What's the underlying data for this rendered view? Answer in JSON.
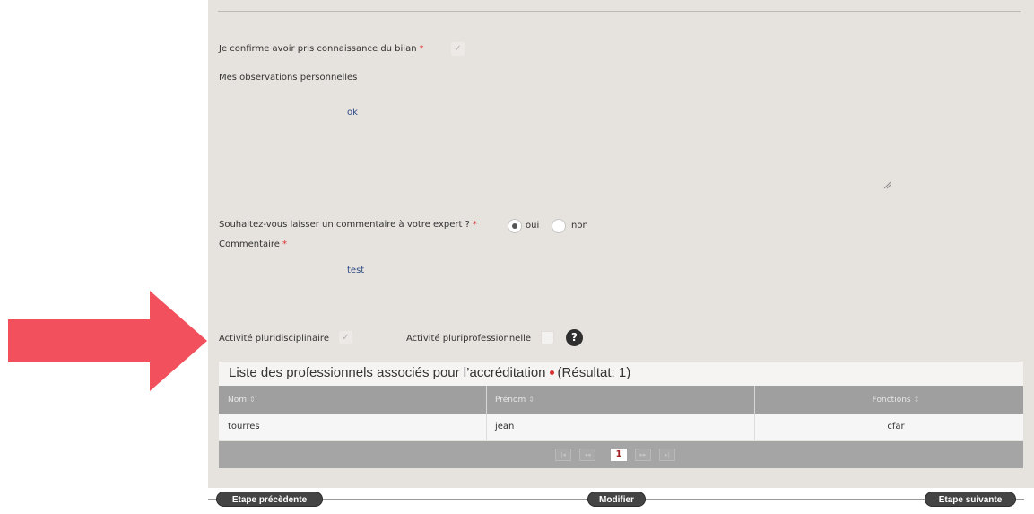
{
  "form": {
    "confirm_label": "Je confirme avoir pris connaissance du bilan",
    "required_mark": "*",
    "observations_label": "Mes observations personnelles",
    "observations_value": "ok",
    "comment_question": "Souhaitez-vous laisser un commentaire à votre expert ?",
    "radio_yes_label": "oui",
    "radio_no_label": "non",
    "radio_selected": "oui",
    "comment_label": "Commentaire",
    "comment_value": "test",
    "activity_pluridisciplinaire_label": "Activité pluridisciplinaire",
    "activity_pluridisciplinaire_checked": true,
    "activity_pluriprofessionnelle_label": "Activité pluriprofessionnelle",
    "activity_pluriprofessionnelle_checked": false,
    "help_glyph": "?"
  },
  "table": {
    "title": "Liste des professionnels associés pour l’accréditation",
    "result_text": "(Résultat: 1)",
    "columns": [
      "Nom",
      "Prénom",
      "Fonctions"
    ],
    "rows": [
      [
        "tourres",
        "jean",
        "cfar"
      ]
    ],
    "pager": {
      "first": "|◂",
      "prev": "◂◂",
      "current_page": "1",
      "next": "▸▸",
      "last": "▸|"
    }
  },
  "navigation": {
    "previous_label": "Etape précèdente",
    "modify_label": "Modifier",
    "next_label": "Etape suivante"
  },
  "annotation": {
    "arrow_color": "#f2505c"
  },
  "colors": {
    "required": "#d9322f",
    "value_text": "#2e4c86",
    "panel_bg": "#e6e2de",
    "table_header_bg": "#9f9f9f",
    "nav_button_bg": "#444444"
  }
}
